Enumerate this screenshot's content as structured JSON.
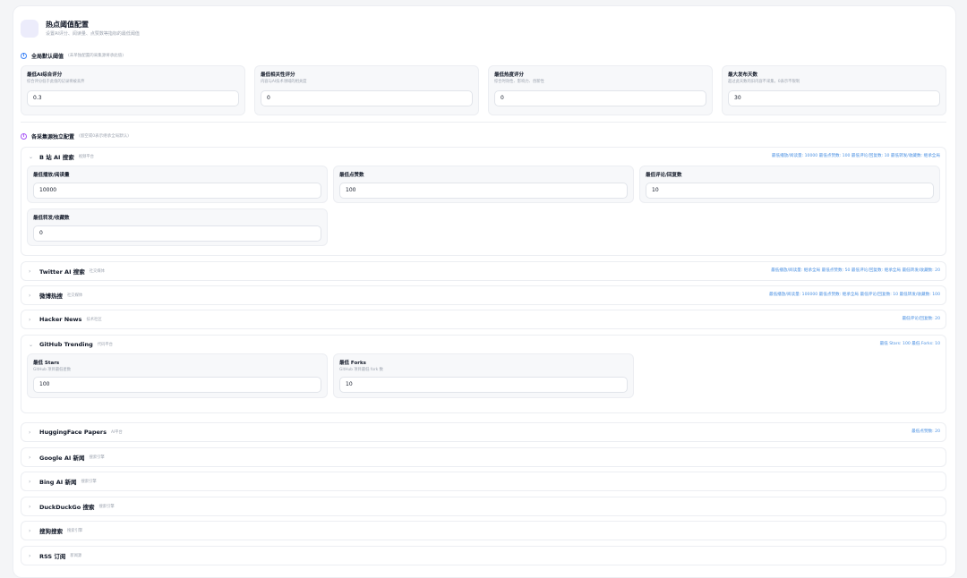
{
  "header": {
    "title": "热点阈值配置",
    "subtitle": "设置AI评分、阅读量、点赞数等指标的最低阈值"
  },
  "global": {
    "title": "全局默认阈值",
    "hint": "(未单独配置的采集源将承此值)",
    "cards": [
      {
        "label": "最低AI综合评分",
        "desc": "综合评分低于此值的记录将被丢弃",
        "value": "0.3"
      },
      {
        "label": "最低相关性评分",
        "desc": "内容与AI技术领域的相关度",
        "value": "0"
      },
      {
        "label": "最低热度评分",
        "desc": "综合时效性、影响力、创新性",
        "value": "0"
      },
      {
        "label": "最大发布天数",
        "desc": "超过此天数的旧内容不采集，0表示不限制",
        "value": "30"
      }
    ]
  },
  "sources_section": {
    "title": "各采集源独立配置",
    "hint": "(留空或0表示继承全局默认)"
  },
  "sources": [
    {
      "title": "B 站 AI 搜索",
      "tag": "视频平台",
      "chevron": "⌄",
      "summary": "最低播放/阅读量: 10000  最低点赞数: 100  最低评论/回复数: 10  最低转发/收藏数: 继承全局",
      "fields": [
        {
          "label": "最低播放/阅读量",
          "value": "10000"
        },
        {
          "label": "最低点赞数",
          "value": "100"
        },
        {
          "label": "最低评论/回复数",
          "value": "10"
        },
        {
          "label": "最低转发/收藏数",
          "value": "0"
        }
      ]
    },
    {
      "title": "Twitter AI 搜索",
      "tag": "社交媒体",
      "chevron": "›",
      "summary": "最低播放/阅读量: 继承全局  最低点赞数: 50  最低评论/回复数: 继承全局  最低转发/收藏数: 20"
    },
    {
      "title": "微博热搜",
      "tag": "社交媒体",
      "chevron": "›",
      "summary": "最低播放/阅读量: 100000  最低点赞数: 继承全局  最低评论/回复数: 10  最低转发/收藏数: 100"
    },
    {
      "title": "Hacker News",
      "tag": "技术社区",
      "chevron": "›",
      "summary": "最低评论/回复数: 20"
    },
    {
      "title": "GitHub Trending",
      "tag": "代码平台",
      "chevron": "⌄",
      "summary": "最低 Stars: 100  最低 Forks: 10",
      "fields": [
        {
          "label": "最低 Stars",
          "desc": "GitHub 项目最低星数",
          "value": "100"
        },
        {
          "label": "最低 Forks",
          "desc": "GitHub 项目最低 fork 数",
          "value": "10"
        }
      ]
    },
    {
      "title": "HuggingFace Papers",
      "tag": "AI平台",
      "chevron": "›",
      "summary": "最低点赞数: 20"
    },
    {
      "title": "Google AI 新闻",
      "tag": "搜索引擎",
      "chevron": "›",
      "summary": ""
    },
    {
      "title": "Bing AI 新闻",
      "tag": "搜索引擎",
      "chevron": "›",
      "summary": ""
    },
    {
      "title": "DuckDuckGo 搜索",
      "tag": "搜索引擎",
      "chevron": "›",
      "summary": ""
    },
    {
      "title": "搜狗搜索",
      "tag": "搜索引擎",
      "chevron": "›",
      "summary": ""
    },
    {
      "title": "RSS 订阅",
      "tag": "新闻源",
      "chevron": "›",
      "summary": ""
    }
  ]
}
